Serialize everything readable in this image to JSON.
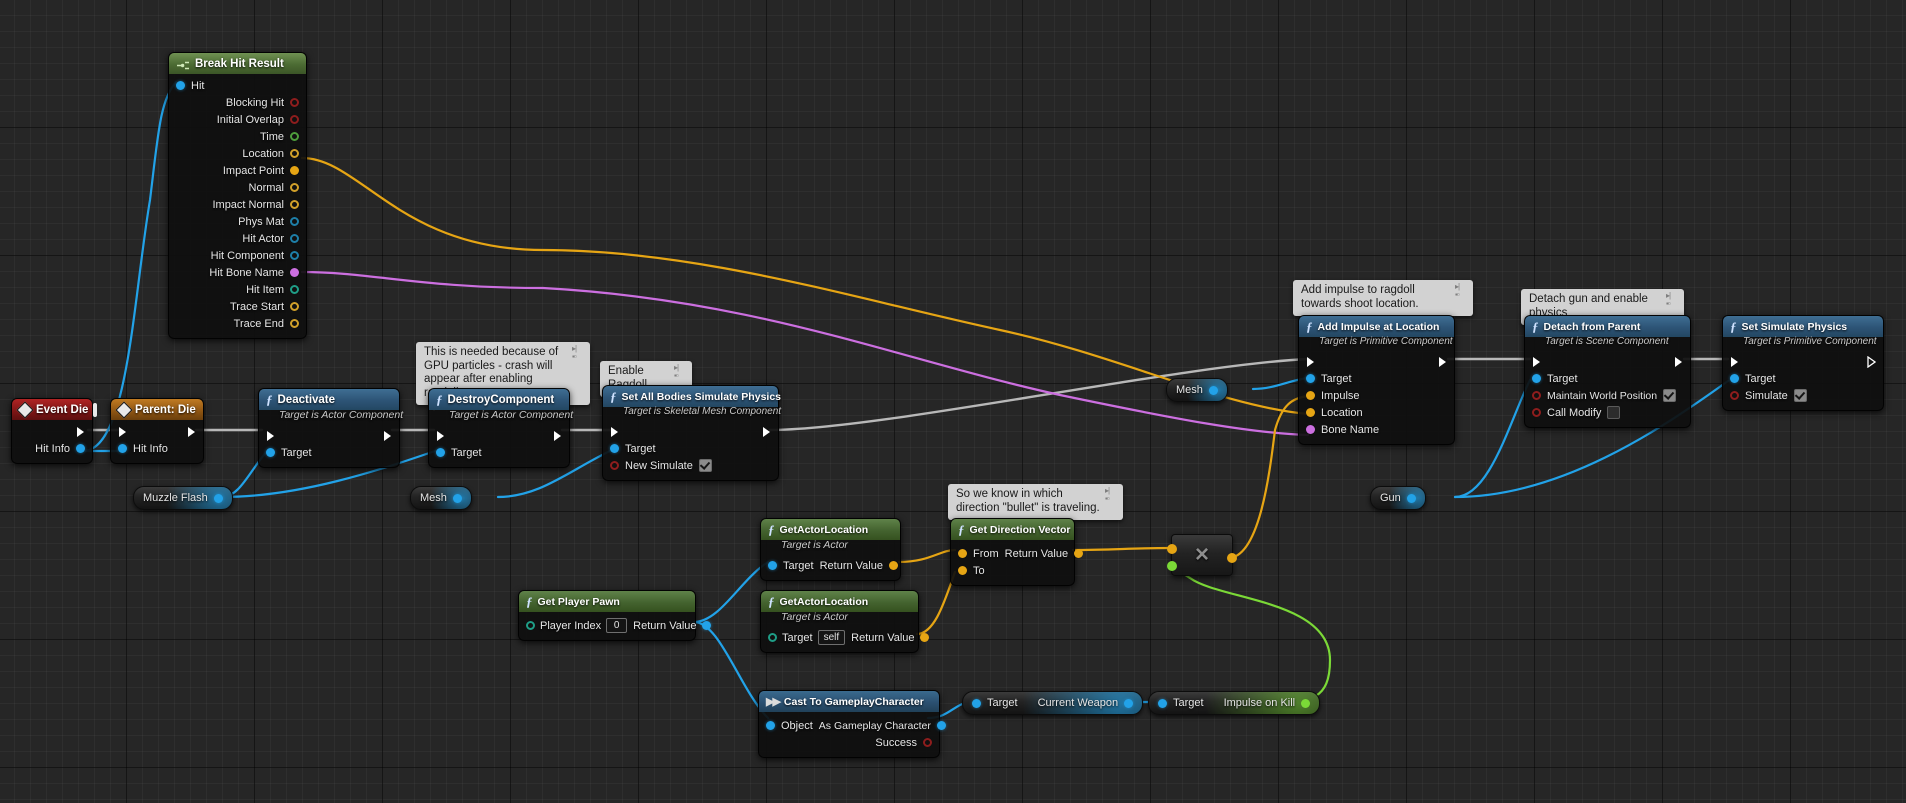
{
  "canvas": {
    "background_color": "#262626",
    "grid_line_color": "#2f2f2f",
    "grid_major_color": "#111111"
  },
  "colors": {
    "exec_wire": "#b8b8b8",
    "object_wire": "#22a2e8",
    "vector_wire": "#e6a514",
    "name_wire": "#cc6fe0",
    "float_wire": "#7bd937",
    "function_header": "#2d5476",
    "pure_header": "#44632f",
    "event_header": "#7d1515",
    "parent_header": "#8d5412"
  },
  "nodes": [
    {
      "id": "break-hit-result",
      "title": "Break Hit Result",
      "subtitle": "",
      "header_style": "break",
      "icon": "break-struct-icon",
      "inputs": [
        {
          "label": "Hit",
          "pin": "blue",
          "filled": true
        }
      ],
      "outputs": [
        {
          "label": "Blocking Hit",
          "pin": "red",
          "filled": false
        },
        {
          "label": "Initial Overlap",
          "pin": "red",
          "filled": false
        },
        {
          "label": "Time",
          "pin": "green",
          "filled": false
        },
        {
          "label": "Location",
          "pin": "yellow",
          "filled": false
        },
        {
          "label": "Impact Point",
          "pin": "yellow",
          "filled": true
        },
        {
          "label": "Normal",
          "pin": "yellow",
          "filled": false
        },
        {
          "label": "Impact Normal",
          "pin": "yellow",
          "filled": false
        },
        {
          "label": "Phys Mat",
          "pin": "cyan",
          "filled": false
        },
        {
          "label": "Hit Actor",
          "pin": "cyan",
          "filled": false
        },
        {
          "label": "Hit Component",
          "pin": "cyan",
          "filled": false
        },
        {
          "label": "Hit Bone Name",
          "pin": "magenta",
          "filled": true
        },
        {
          "label": "Hit Item",
          "pin": "teal",
          "filled": false
        },
        {
          "label": "Trace Start",
          "pin": "yellow",
          "filled": false
        },
        {
          "label": "Trace End",
          "pin": "yellow",
          "filled": false
        }
      ]
    },
    {
      "id": "event-die",
      "title": "Event Die",
      "header_style": "event",
      "icon": "event-diamond-icon",
      "has_event_badge": true,
      "outputs": [
        {
          "label": "Hit Info",
          "pin": "blue",
          "filled": true
        }
      ]
    },
    {
      "id": "parent-die",
      "title": "Parent: Die",
      "header_style": "parent",
      "icon": "parent-diamond-icon",
      "inputs": [
        {
          "label": "Hit Info",
          "pin": "blue",
          "filled": true
        }
      ]
    },
    {
      "id": "deactivate",
      "title": "Deactivate",
      "subtitle": "Target is Actor Component",
      "header_style": "fn",
      "icon": "function-f-icon",
      "inputs": [
        {
          "label": "Target",
          "pin": "blue",
          "filled": true
        }
      ]
    },
    {
      "id": "destroy-component",
      "title": "DestroyComponent",
      "subtitle": "Target is Actor Component",
      "header_style": "fn",
      "icon": "function-f-icon",
      "inputs": [
        {
          "label": "Target",
          "pin": "blue",
          "filled": true
        }
      ]
    },
    {
      "id": "set-all-bodies-simulate-physics",
      "title": "Set All Bodies Simulate Physics",
      "subtitle": "Target is Skeletal Mesh Component",
      "header_style": "fn",
      "icon": "function-f-icon",
      "inputs": [
        {
          "label": "Target",
          "pin": "blue",
          "filled": true
        },
        {
          "label": "New Simulate",
          "pin": "red",
          "filled": false,
          "checkbox": true,
          "checked": true
        }
      ]
    },
    {
      "id": "add-impulse-at-location",
      "title": "Add Impulse at Location",
      "subtitle": "Target is Primitive Component",
      "header_style": "fn",
      "icon": "function-f-icon",
      "inputs": [
        {
          "label": "Target",
          "pin": "blue",
          "filled": true
        },
        {
          "label": "Impulse",
          "pin": "yellow",
          "filled": true
        },
        {
          "label": "Location",
          "pin": "yellow",
          "filled": true
        },
        {
          "label": "Bone Name",
          "pin": "magenta",
          "filled": true
        }
      ]
    },
    {
      "id": "detach-from-parent",
      "title": "Detach from Parent",
      "subtitle": "Target is Scene Component",
      "header_style": "fn",
      "icon": "function-f-icon",
      "inputs": [
        {
          "label": "Target",
          "pin": "blue",
          "filled": true
        },
        {
          "label": "Maintain World Position",
          "pin": "red",
          "filled": false,
          "checkbox": true,
          "checked": true
        },
        {
          "label": "Call Modify",
          "pin": "red",
          "filled": false,
          "checkbox": true,
          "checked": false
        }
      ]
    },
    {
      "id": "set-simulate-physics",
      "title": "Set Simulate Physics",
      "subtitle": "Target is Primitive Component",
      "header_style": "fn",
      "icon": "function-f-icon",
      "inputs": [
        {
          "label": "Target",
          "pin": "blue",
          "filled": true
        },
        {
          "label": "Simulate",
          "pin": "red",
          "filled": false,
          "checkbox": true,
          "checked": true
        }
      ]
    },
    {
      "id": "get-actor-location-1",
      "title": "GetActorLocation",
      "subtitle": "Target is Actor",
      "header_style": "pure",
      "icon": "function-f-icon",
      "inputs": [
        {
          "label": "Target",
          "pin": "blue",
          "filled": true
        }
      ],
      "outputs": [
        {
          "label": "Return Value",
          "pin": "yellow",
          "filled": true
        }
      ]
    },
    {
      "id": "get-actor-location-2",
      "title": "GetActorLocation",
      "subtitle": "Target is Actor",
      "header_style": "pure",
      "icon": "function-f-icon",
      "inputs": [
        {
          "label": "Target",
          "pin": "teal",
          "filled": false,
          "value": "self"
        }
      ],
      "outputs": [
        {
          "label": "Return Value",
          "pin": "yellow",
          "filled": true
        }
      ]
    },
    {
      "id": "get-player-pawn",
      "title": "Get Player Pawn",
      "subtitle": "",
      "header_style": "pure",
      "icon": "function-f-icon",
      "inputs": [
        {
          "label": "Player Index",
          "pin": "teal",
          "filled": false,
          "value": "0"
        }
      ],
      "outputs": [
        {
          "label": "Return Value",
          "pin": "blue",
          "filled": true
        }
      ]
    },
    {
      "id": "get-direction-vector",
      "title": "Get Direction Vector",
      "subtitle": "",
      "header_style": "pure",
      "icon": "function-f-icon",
      "inputs": [
        {
          "label": "From",
          "pin": "yellow",
          "filled": true
        },
        {
          "label": "To",
          "pin": "yellow",
          "filled": true
        }
      ],
      "outputs": [
        {
          "label": "Return Value",
          "pin": "yellow",
          "filled": true
        }
      ]
    },
    {
      "id": "multiply",
      "title": "",
      "operator": "×",
      "header_style": "compact",
      "icon": "multiply-icon",
      "inputs": [
        {
          "label": "",
          "pin": "yellow",
          "filled": true
        },
        {
          "label": "",
          "pin": "lime",
          "filled": true
        }
      ],
      "outputs": [
        {
          "label": "",
          "pin": "yellow",
          "filled": true
        }
      ]
    },
    {
      "id": "cast-to-gameplaycharacter",
      "title": "Cast To GameplayCharacter",
      "subtitle": "",
      "header_style": "cast",
      "icon": "cast-arrow-icon",
      "inputs": [
        {
          "label": "Object",
          "pin": "blue",
          "filled": true
        }
      ],
      "outputs": [
        {
          "label": "As Gameplay Character",
          "pin": "blue",
          "filled": true
        },
        {
          "label": "Success",
          "pin": "red",
          "filled": false
        }
      ]
    }
  ],
  "variable_getters": [
    {
      "id": "muzzle-flash",
      "label": "Muzzle Flash",
      "pin": "blue"
    },
    {
      "id": "mesh-left",
      "label": "Mesh",
      "pin": "blue"
    },
    {
      "id": "mesh-right",
      "label": "Mesh",
      "pin": "blue"
    },
    {
      "id": "gun",
      "label": "Gun",
      "pin": "blue"
    },
    {
      "id": "current-weapon",
      "target_label": "Target",
      "label": "Current Weapon",
      "pin": "blue"
    },
    {
      "id": "impulse-on-kill",
      "target_label": "Target",
      "label": "Impulse on Kill",
      "pin": "lime"
    }
  ],
  "comments": [
    {
      "id": "gpu-particles-comment",
      "text": "This is needed because of GPU particles - crash will appear after enabling ragdoll"
    },
    {
      "id": "enable-ragdoll-comment",
      "text": "Enable Ragdoll"
    },
    {
      "id": "add-impulse-comment",
      "text": "Add impulse to ragdoll towards shoot location."
    },
    {
      "id": "detach-gun-comment",
      "text": "Detach gun and enable physics"
    },
    {
      "id": "bullet-direction-comment",
      "text": "So we know in which direction \"bullet\" is traveling."
    }
  ]
}
